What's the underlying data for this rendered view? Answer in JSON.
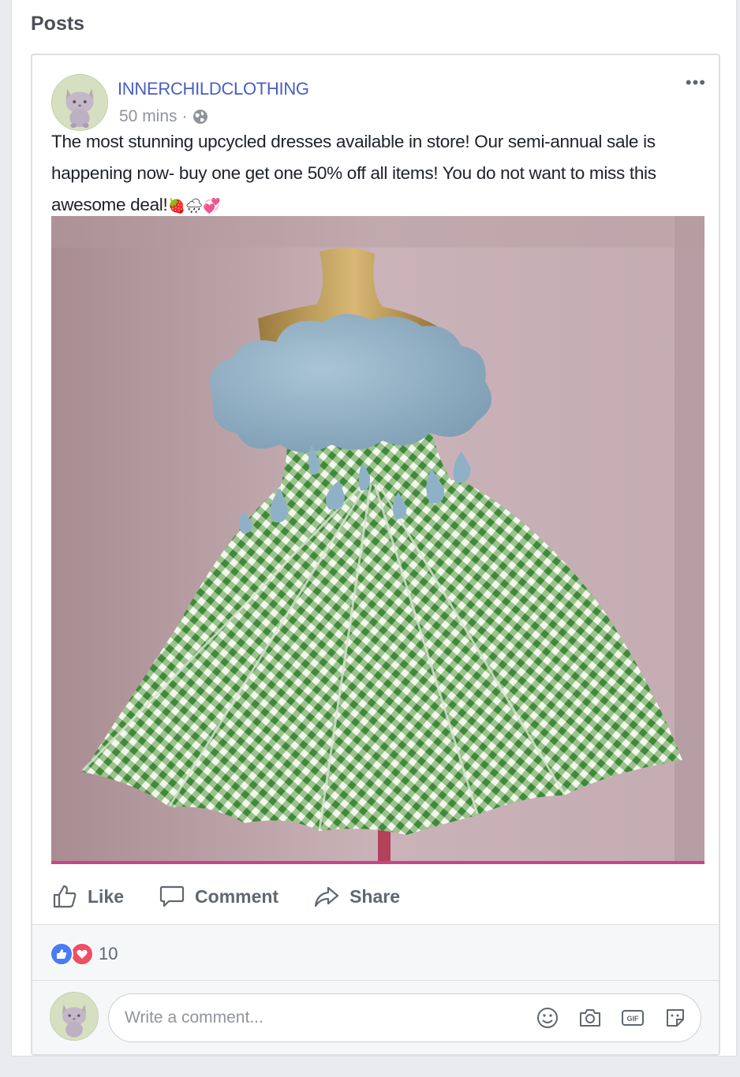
{
  "section": {
    "title": "Posts"
  },
  "post": {
    "author": "INNERCHILDCLOTHING",
    "time": "50 mins",
    "separator": "·",
    "more": "•••",
    "text": "The most stunning upcycled dresses available in store! Our semi-annual sale is happening now- buy one get one 50% off all items! You do not want to miss this awesome deal!",
    "emojis": [
      "🍓",
      "🌧",
      "💞"
    ],
    "photo_icon": "umbrella-dress-photo"
  },
  "actions": {
    "like_label": "Like",
    "comment_label": "Comment",
    "share_label": "Share"
  },
  "reactions": {
    "count": "10",
    "types": [
      "like",
      "love"
    ]
  },
  "comment_box": {
    "placeholder": "Write a comment...",
    "value": "",
    "icons": [
      "smiley-icon",
      "camera-icon",
      "gif-icon",
      "sticker-icon"
    ]
  },
  "colors": {
    "author": "#4a5ec2",
    "like": "#4b7bf5",
    "love": "#ef4e63",
    "muted": "#606770"
  }
}
